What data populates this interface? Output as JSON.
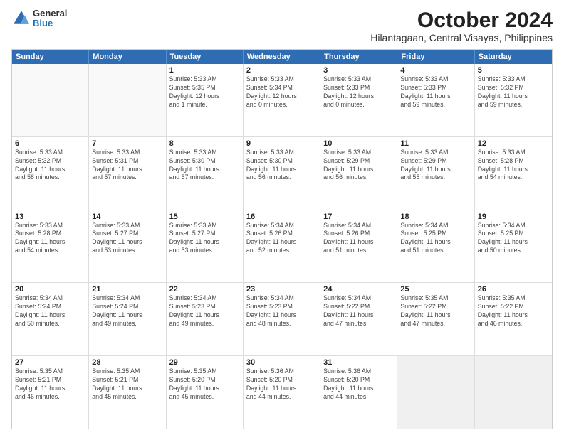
{
  "header": {
    "logo": {
      "general": "General",
      "blue": "Blue"
    },
    "title": "October 2024",
    "subtitle": "Hilantagaan, Central Visayas, Philippines"
  },
  "days_of_week": [
    "Sunday",
    "Monday",
    "Tuesday",
    "Wednesday",
    "Thursday",
    "Friday",
    "Saturday"
  ],
  "weeks": [
    [
      {
        "day": "",
        "text": ""
      },
      {
        "day": "",
        "text": ""
      },
      {
        "day": "1",
        "text": "Sunrise: 5:33 AM\nSunset: 5:35 PM\nDaylight: 12 hours\nand 1 minute."
      },
      {
        "day": "2",
        "text": "Sunrise: 5:33 AM\nSunset: 5:34 PM\nDaylight: 12 hours\nand 0 minutes."
      },
      {
        "day": "3",
        "text": "Sunrise: 5:33 AM\nSunset: 5:33 PM\nDaylight: 12 hours\nand 0 minutes."
      },
      {
        "day": "4",
        "text": "Sunrise: 5:33 AM\nSunset: 5:33 PM\nDaylight: 11 hours\nand 59 minutes."
      },
      {
        "day": "5",
        "text": "Sunrise: 5:33 AM\nSunset: 5:32 PM\nDaylight: 11 hours\nand 59 minutes."
      }
    ],
    [
      {
        "day": "6",
        "text": "Sunrise: 5:33 AM\nSunset: 5:32 PM\nDaylight: 11 hours\nand 58 minutes."
      },
      {
        "day": "7",
        "text": "Sunrise: 5:33 AM\nSunset: 5:31 PM\nDaylight: 11 hours\nand 57 minutes."
      },
      {
        "day": "8",
        "text": "Sunrise: 5:33 AM\nSunset: 5:30 PM\nDaylight: 11 hours\nand 57 minutes."
      },
      {
        "day": "9",
        "text": "Sunrise: 5:33 AM\nSunset: 5:30 PM\nDaylight: 11 hours\nand 56 minutes."
      },
      {
        "day": "10",
        "text": "Sunrise: 5:33 AM\nSunset: 5:29 PM\nDaylight: 11 hours\nand 56 minutes."
      },
      {
        "day": "11",
        "text": "Sunrise: 5:33 AM\nSunset: 5:29 PM\nDaylight: 11 hours\nand 55 minutes."
      },
      {
        "day": "12",
        "text": "Sunrise: 5:33 AM\nSunset: 5:28 PM\nDaylight: 11 hours\nand 54 minutes."
      }
    ],
    [
      {
        "day": "13",
        "text": "Sunrise: 5:33 AM\nSunset: 5:28 PM\nDaylight: 11 hours\nand 54 minutes."
      },
      {
        "day": "14",
        "text": "Sunrise: 5:33 AM\nSunset: 5:27 PM\nDaylight: 11 hours\nand 53 minutes."
      },
      {
        "day": "15",
        "text": "Sunrise: 5:33 AM\nSunset: 5:27 PM\nDaylight: 11 hours\nand 53 minutes."
      },
      {
        "day": "16",
        "text": "Sunrise: 5:34 AM\nSunset: 5:26 PM\nDaylight: 11 hours\nand 52 minutes."
      },
      {
        "day": "17",
        "text": "Sunrise: 5:34 AM\nSunset: 5:26 PM\nDaylight: 11 hours\nand 51 minutes."
      },
      {
        "day": "18",
        "text": "Sunrise: 5:34 AM\nSunset: 5:25 PM\nDaylight: 11 hours\nand 51 minutes."
      },
      {
        "day": "19",
        "text": "Sunrise: 5:34 AM\nSunset: 5:25 PM\nDaylight: 11 hours\nand 50 minutes."
      }
    ],
    [
      {
        "day": "20",
        "text": "Sunrise: 5:34 AM\nSunset: 5:24 PM\nDaylight: 11 hours\nand 50 minutes."
      },
      {
        "day": "21",
        "text": "Sunrise: 5:34 AM\nSunset: 5:24 PM\nDaylight: 11 hours\nand 49 minutes."
      },
      {
        "day": "22",
        "text": "Sunrise: 5:34 AM\nSunset: 5:23 PM\nDaylight: 11 hours\nand 49 minutes."
      },
      {
        "day": "23",
        "text": "Sunrise: 5:34 AM\nSunset: 5:23 PM\nDaylight: 11 hours\nand 48 minutes."
      },
      {
        "day": "24",
        "text": "Sunrise: 5:34 AM\nSunset: 5:22 PM\nDaylight: 11 hours\nand 47 minutes."
      },
      {
        "day": "25",
        "text": "Sunrise: 5:35 AM\nSunset: 5:22 PM\nDaylight: 11 hours\nand 47 minutes."
      },
      {
        "day": "26",
        "text": "Sunrise: 5:35 AM\nSunset: 5:22 PM\nDaylight: 11 hours\nand 46 minutes."
      }
    ],
    [
      {
        "day": "27",
        "text": "Sunrise: 5:35 AM\nSunset: 5:21 PM\nDaylight: 11 hours\nand 46 minutes."
      },
      {
        "day": "28",
        "text": "Sunrise: 5:35 AM\nSunset: 5:21 PM\nDaylight: 11 hours\nand 45 minutes."
      },
      {
        "day": "29",
        "text": "Sunrise: 5:35 AM\nSunset: 5:20 PM\nDaylight: 11 hours\nand 45 minutes."
      },
      {
        "day": "30",
        "text": "Sunrise: 5:36 AM\nSunset: 5:20 PM\nDaylight: 11 hours\nand 44 minutes."
      },
      {
        "day": "31",
        "text": "Sunrise: 5:36 AM\nSunset: 5:20 PM\nDaylight: 11 hours\nand 44 minutes."
      },
      {
        "day": "",
        "text": ""
      },
      {
        "day": "",
        "text": ""
      }
    ]
  ]
}
